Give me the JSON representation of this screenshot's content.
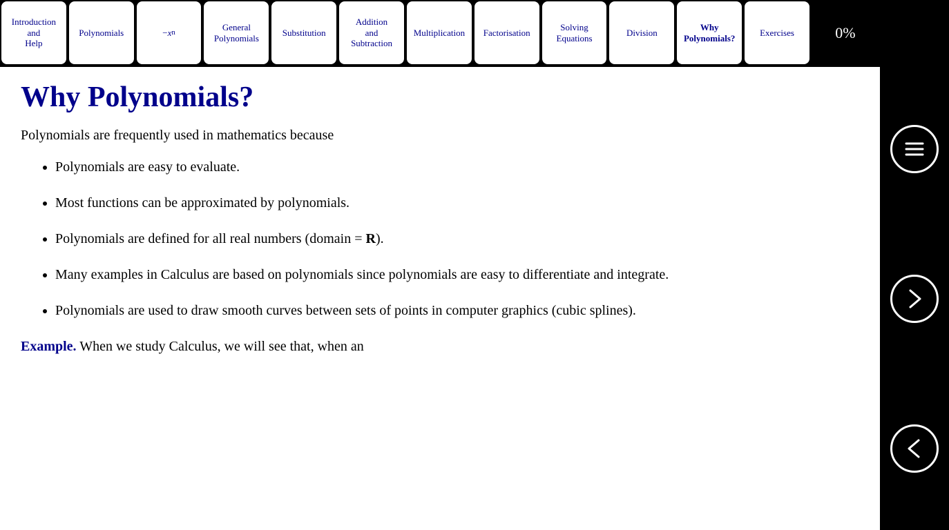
{
  "nav": {
    "tabs": [
      {
        "id": "intro",
        "label": "Introduction\nand\nHelp",
        "active": false
      },
      {
        "id": "polynomials",
        "label": "Polynomials",
        "active": false
      },
      {
        "id": "neg-xn",
        "label": "−xⁿ",
        "active": false,
        "math": true
      },
      {
        "id": "general-polynomials",
        "label": "General\nPolynomials",
        "active": false
      },
      {
        "id": "substitution",
        "label": "Substitution",
        "active": false
      },
      {
        "id": "addition-subtraction",
        "label": "Addition\nand\nSubtraction",
        "active": false
      },
      {
        "id": "multiplication",
        "label": "Multiplication",
        "active": false
      },
      {
        "id": "factorisation",
        "label": "Factorisation",
        "active": false
      },
      {
        "id": "solving-equations",
        "label": "Solving\nEquations",
        "active": false
      },
      {
        "id": "division",
        "label": "Division",
        "active": false
      },
      {
        "id": "why-polynomials",
        "label": "Why\nPolynomials?",
        "active": true
      },
      {
        "id": "exercises",
        "label": "Exercises",
        "active": false
      }
    ],
    "progress": "0%"
  },
  "content": {
    "title": "Why Polynomials?",
    "intro": "Polynomials are frequently used in mathematics because",
    "bullets": [
      "Polynomials are easy to evaluate.",
      "Most functions can be approximated by polynomials.",
      "Polynomials are defined for all real numbers (domain = R).",
      "Many examples in Calculus are based on polynomials since polynomials are easy to differentiate and integrate.",
      "Polynomials are used to draw smooth curves between sets of points in computer graphics (cubic splines)."
    ],
    "example_label": "Example.",
    "example_text": " When we study Calculus, we will see that, when an"
  },
  "sidebar": {
    "menu_label": "menu",
    "next_label": "next",
    "back_label": "back"
  }
}
